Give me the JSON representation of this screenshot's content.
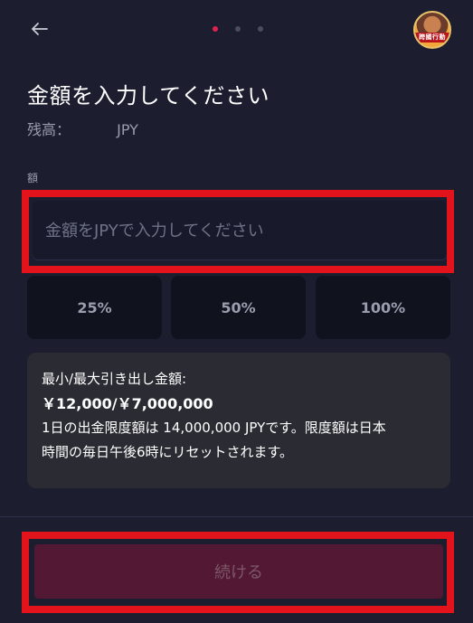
{
  "header": {
    "back_icon": "arrow-left-icon",
    "steps": {
      "total": 3,
      "current": 1
    },
    "avatar_text": "跨國行動"
  },
  "title": "金額を入力してください",
  "balance": {
    "label": "残高：",
    "currency": "JPY"
  },
  "amount_field": {
    "label": "額",
    "placeholder": "金額をJPYで入力してください",
    "value": ""
  },
  "percent_buttons": [
    "25%",
    "50%",
    "100%"
  ],
  "limits": {
    "title": "最小/最大引き出し金額:",
    "range": "￥12,000/￥7,000,000",
    "daily_limit_line1": "1日の出金限度額は 14,000,000 JPYです。限度額は日本",
    "daily_limit_line2": "時間の毎日午後6時にリセットされます。"
  },
  "continue_label": "続ける",
  "colors": {
    "background": "#1c1e30",
    "accent": "#e0234e",
    "highlight": "#e3131c",
    "button_disabled": "#531834"
  }
}
